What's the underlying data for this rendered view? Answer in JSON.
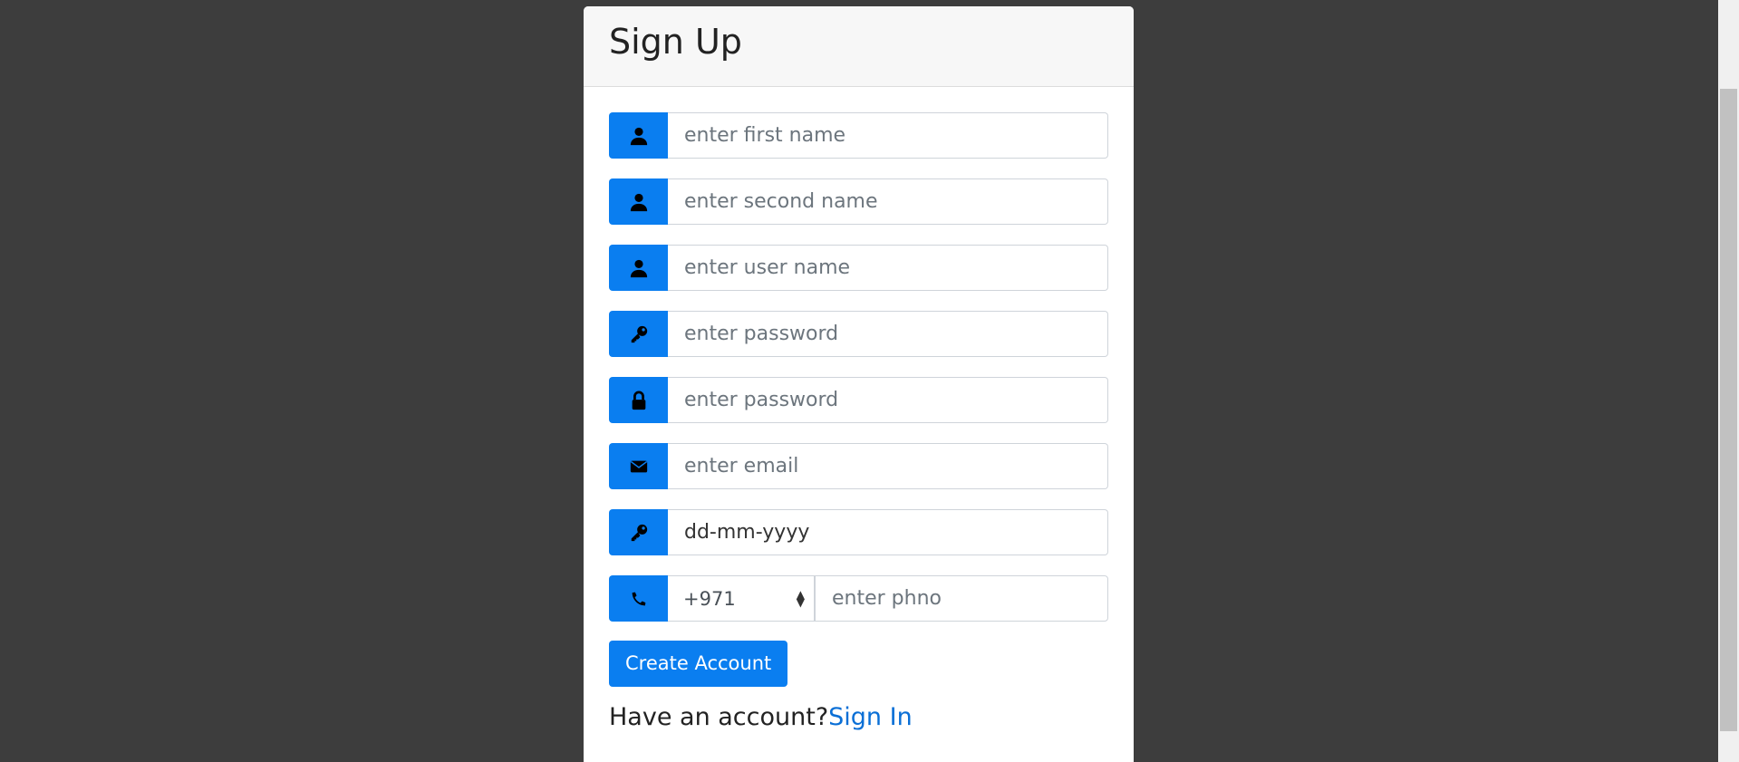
{
  "card": {
    "title": "Sign Up"
  },
  "form": {
    "first_name": {
      "placeholder": "enter first name",
      "icon": "user-icon"
    },
    "second_name": {
      "placeholder": "enter second name",
      "icon": "user-icon"
    },
    "user_name": {
      "placeholder": "enter user name",
      "icon": "user-icon"
    },
    "password": {
      "placeholder": "enter password",
      "icon": "key-icon"
    },
    "confirm_password": {
      "placeholder": "enter password",
      "icon": "lock-icon"
    },
    "email": {
      "placeholder": "enter email",
      "icon": "envelope-icon"
    },
    "dob": {
      "value": "dd-mm-yyyy",
      "icon": "key-icon"
    },
    "phone": {
      "country_code": "+971",
      "placeholder": "enter phno",
      "icon": "phone-icon"
    },
    "submit_label": "Create Account"
  },
  "footer": {
    "prompt": "Have an account?",
    "link_label": "Sign In"
  },
  "colors": {
    "accent": "#0a7ef0",
    "background": "#3d3d3d",
    "link": "#0a6fd6"
  }
}
